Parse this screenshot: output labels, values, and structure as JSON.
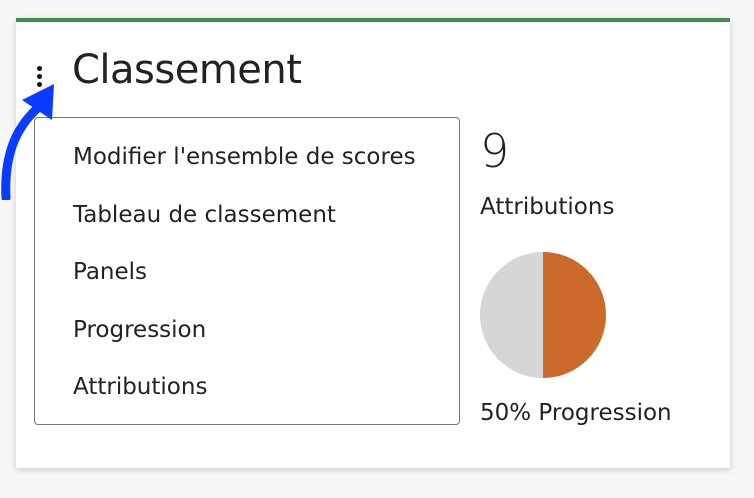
{
  "widget": {
    "title": "Classement",
    "menu_icon": "kebab-vertical-icon",
    "accent_color": "#3f8f4a"
  },
  "menu": {
    "items": [
      {
        "label": "Modifier l'ensemble de scores"
      },
      {
        "label": "Tableau de classement"
      },
      {
        "label": "Panels"
      },
      {
        "label": "Progression"
      },
      {
        "label": "Attributions"
      }
    ]
  },
  "stats": {
    "attributions_count": "9",
    "attributions_label": "Attributions",
    "progress_label": "50% Progression",
    "progress_value": 0.5,
    "progress_color": "#cc6a2b",
    "remaining_color": "#d6d6d6"
  },
  "annotation": {
    "arrow_color": "#0a3cff"
  }
}
